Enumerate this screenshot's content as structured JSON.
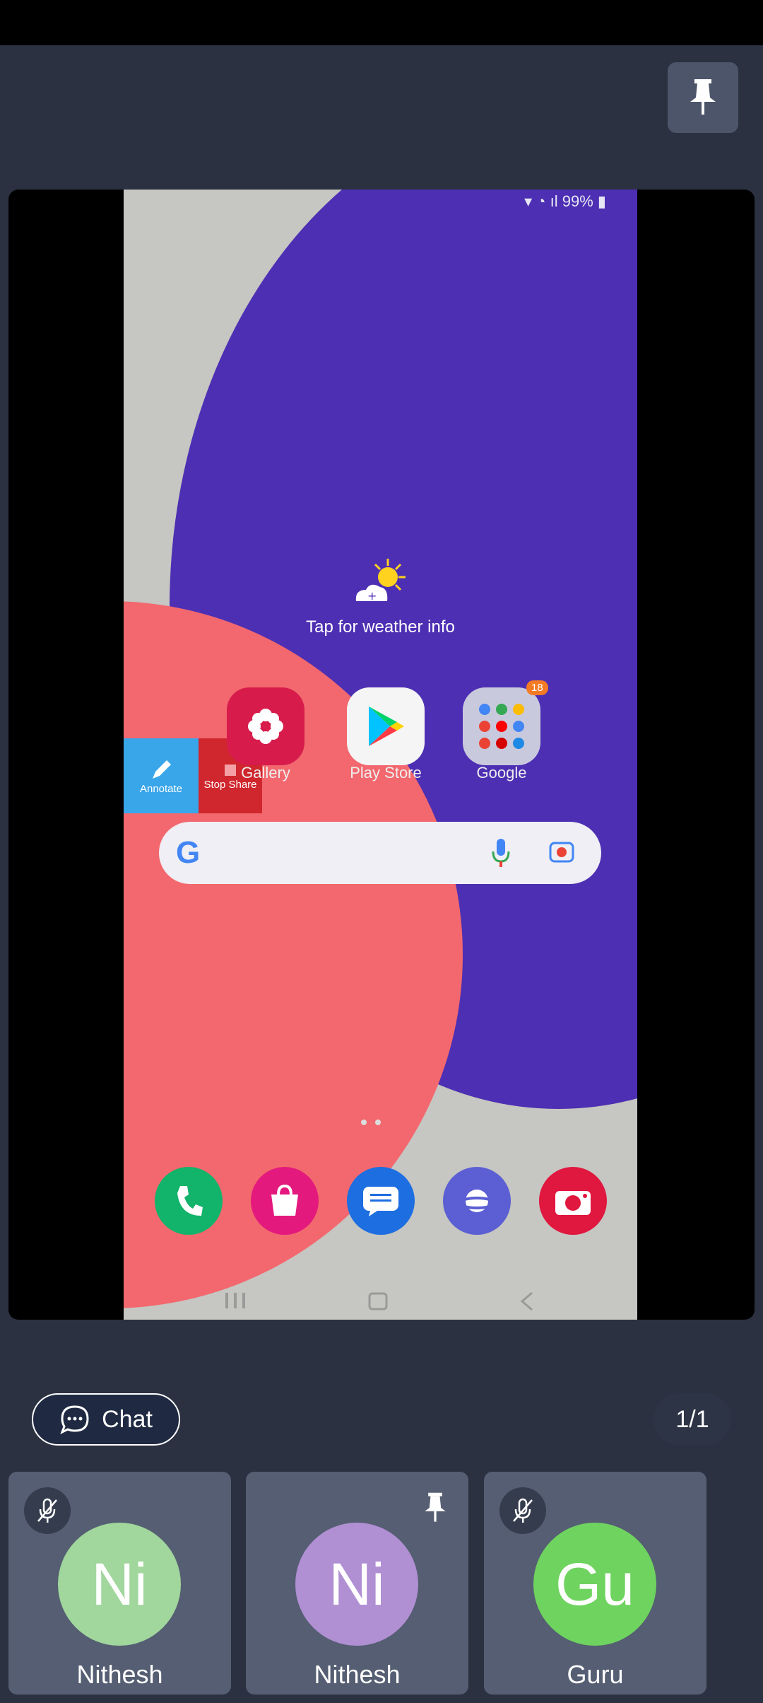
{
  "colors": {
    "background": "#2b3141",
    "tile": "#555e72",
    "avatar_green_light": "#a1d69c",
    "avatar_purple": "#b08fd3",
    "avatar_green": "#6fd35f"
  },
  "pin_button": {
    "icon": "pin-icon"
  },
  "shared_screen": {
    "status_text": "99%",
    "weather_text": "Tap for weather info",
    "annotate_label": "Annotate",
    "stop_share_label": "Stop Share",
    "apps": [
      {
        "label": "Gallery"
      },
      {
        "label": "Play Store"
      },
      {
        "label": "Google",
        "badge": "18"
      }
    ],
    "dock_icons": [
      "phone-icon",
      "store-icon",
      "messages-icon",
      "internet-icon",
      "camera-icon"
    ]
  },
  "chat": {
    "label": "Chat",
    "icon": "chat-icon"
  },
  "page_indicator": "1/1",
  "participants": [
    {
      "initials": "Ni",
      "name": "Nithesh",
      "muted": true,
      "pinned": false
    },
    {
      "initials": "Ni",
      "name": "Nithesh",
      "muted": false,
      "pinned": true
    },
    {
      "initials": "Gu",
      "name": "Guru",
      "muted": true,
      "pinned": false
    }
  ]
}
